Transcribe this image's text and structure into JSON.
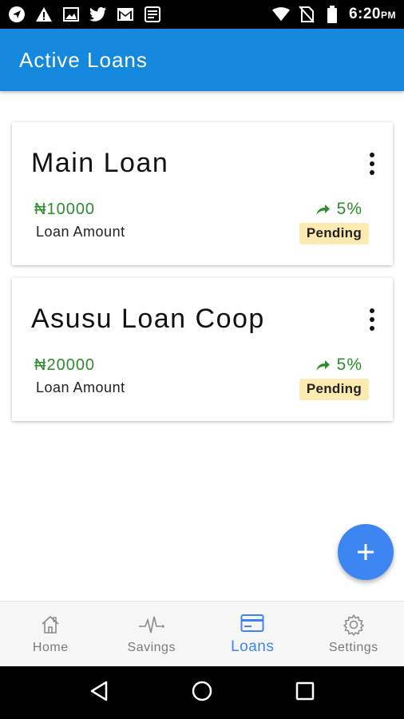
{
  "status_bar": {
    "time": "6:20",
    "ampm": "PM",
    "icons": [
      "navigation-icon",
      "warning-icon",
      "image-icon",
      "twitter-icon",
      "gmail-icon",
      "notes-icon",
      "wifi-icon",
      "no-sim-icon",
      "battery-icon"
    ]
  },
  "app_bar": {
    "title": "Active Loans"
  },
  "loans": [
    {
      "title": "Main Loan",
      "amount": "₦10000",
      "amount_label": "Loan Amount",
      "rate": "5%",
      "status": "Pending"
    },
    {
      "title": "Asusu Loan Coop",
      "amount": "₦20000",
      "amount_label": "Loan Amount",
      "rate": "5%",
      "status": "Pending"
    }
  ],
  "fab": {
    "icon": "plus-icon"
  },
  "bottom_nav": {
    "items": [
      {
        "label": "Home",
        "icon": "home-icon",
        "active": false
      },
      {
        "label": "Savings",
        "icon": "pulse-icon",
        "active": false
      },
      {
        "label": "Loans",
        "icon": "card-icon",
        "active": true
      },
      {
        "label": "Settings",
        "icon": "gear-icon",
        "active": false
      }
    ]
  },
  "colors": {
    "app_bar": "#1488dc",
    "accent": "#3d85f0",
    "amount_green": "#2e8b2e",
    "badge_bg": "#fdeab1"
  }
}
